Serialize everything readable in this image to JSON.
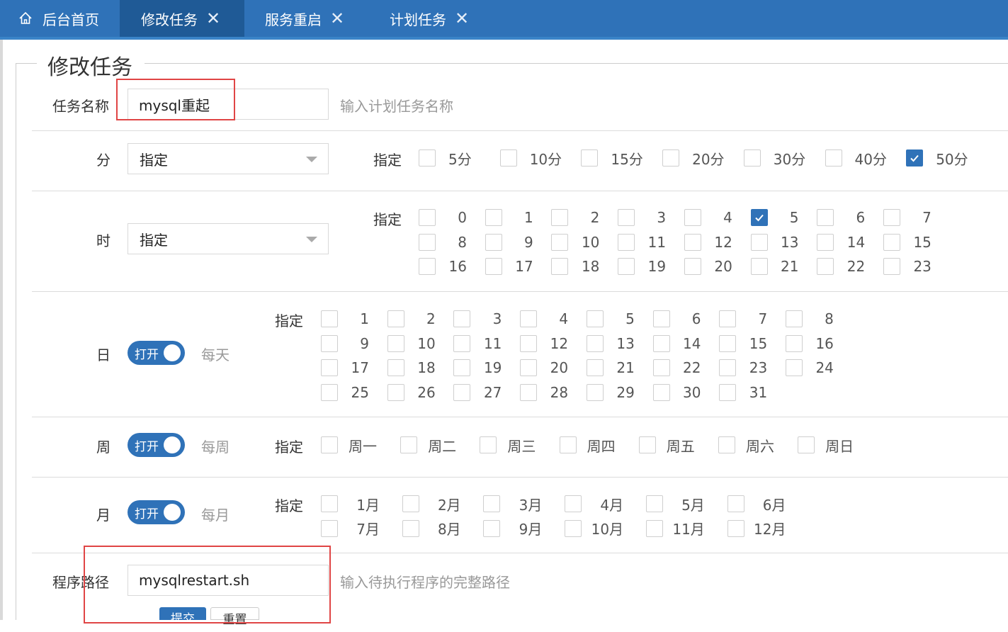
{
  "tabs": [
    {
      "label": "后台首页",
      "icon": "home-icon"
    },
    {
      "label": "修改任务",
      "closable": true
    },
    {
      "label": "服务重启",
      "closable": true
    },
    {
      "label": "计划任务",
      "closable": true
    }
  ],
  "active_tab": "修改任务",
  "form": {
    "legend": "修改任务",
    "task_name": {
      "label": "任务名称",
      "value": "mysql重起",
      "hint": "输入计划任务名称"
    },
    "minute": {
      "label": "分",
      "select_value": "指定",
      "specify_label": "指定",
      "options": [
        {
          "label": "5分",
          "checked": false
        },
        {
          "label": "10分",
          "checked": false
        },
        {
          "label": "15分",
          "checked": false
        },
        {
          "label": "20分",
          "checked": false
        },
        {
          "label": "30分",
          "checked": false
        },
        {
          "label": "40分",
          "checked": false
        },
        {
          "label": "50分",
          "checked": true
        }
      ]
    },
    "hour": {
      "label": "时",
      "select_value": "指定",
      "specify_label": "指定",
      "options": [
        "0",
        "1",
        "2",
        "3",
        "4",
        "5",
        "6",
        "7",
        "8",
        "9",
        "10",
        "11",
        "12",
        "13",
        "14",
        "15",
        "16",
        "17",
        "18",
        "19",
        "20",
        "21",
        "22",
        "23"
      ],
      "checked": [
        "5"
      ]
    },
    "day": {
      "label": "日",
      "toggle_label": "打开",
      "toggle_on": true,
      "every_label": "每天",
      "specify_label": "指定",
      "options": [
        "1",
        "2",
        "3",
        "4",
        "5",
        "6",
        "7",
        "8",
        "9",
        "10",
        "11",
        "12",
        "13",
        "14",
        "15",
        "16",
        "17",
        "18",
        "19",
        "20",
        "21",
        "22",
        "23",
        "24",
        "25",
        "26",
        "27",
        "28",
        "29",
        "30",
        "31"
      ]
    },
    "week": {
      "label": "周",
      "toggle_label": "打开",
      "toggle_on": true,
      "every_label": "每周",
      "specify_label": "指定",
      "options": [
        "周一",
        "周二",
        "周三",
        "周四",
        "周五",
        "周六",
        "周日"
      ]
    },
    "month": {
      "label": "月",
      "toggle_label": "打开",
      "toggle_on": true,
      "every_label": "每月",
      "specify_label": "指定",
      "options": [
        "1月",
        "2月",
        "3月",
        "4月",
        "5月",
        "6月",
        "7月",
        "8月",
        "9月",
        "10月",
        "11月",
        "12月"
      ]
    },
    "program_path": {
      "label": "程序路径",
      "value": "mysqlrestart.sh",
      "hint": "输入待执行程序的完整路径"
    },
    "submit_label": "提交",
    "reset_label": "重置"
  },
  "colors": {
    "primary": "#2f72b8",
    "highlight": "#e04545"
  }
}
